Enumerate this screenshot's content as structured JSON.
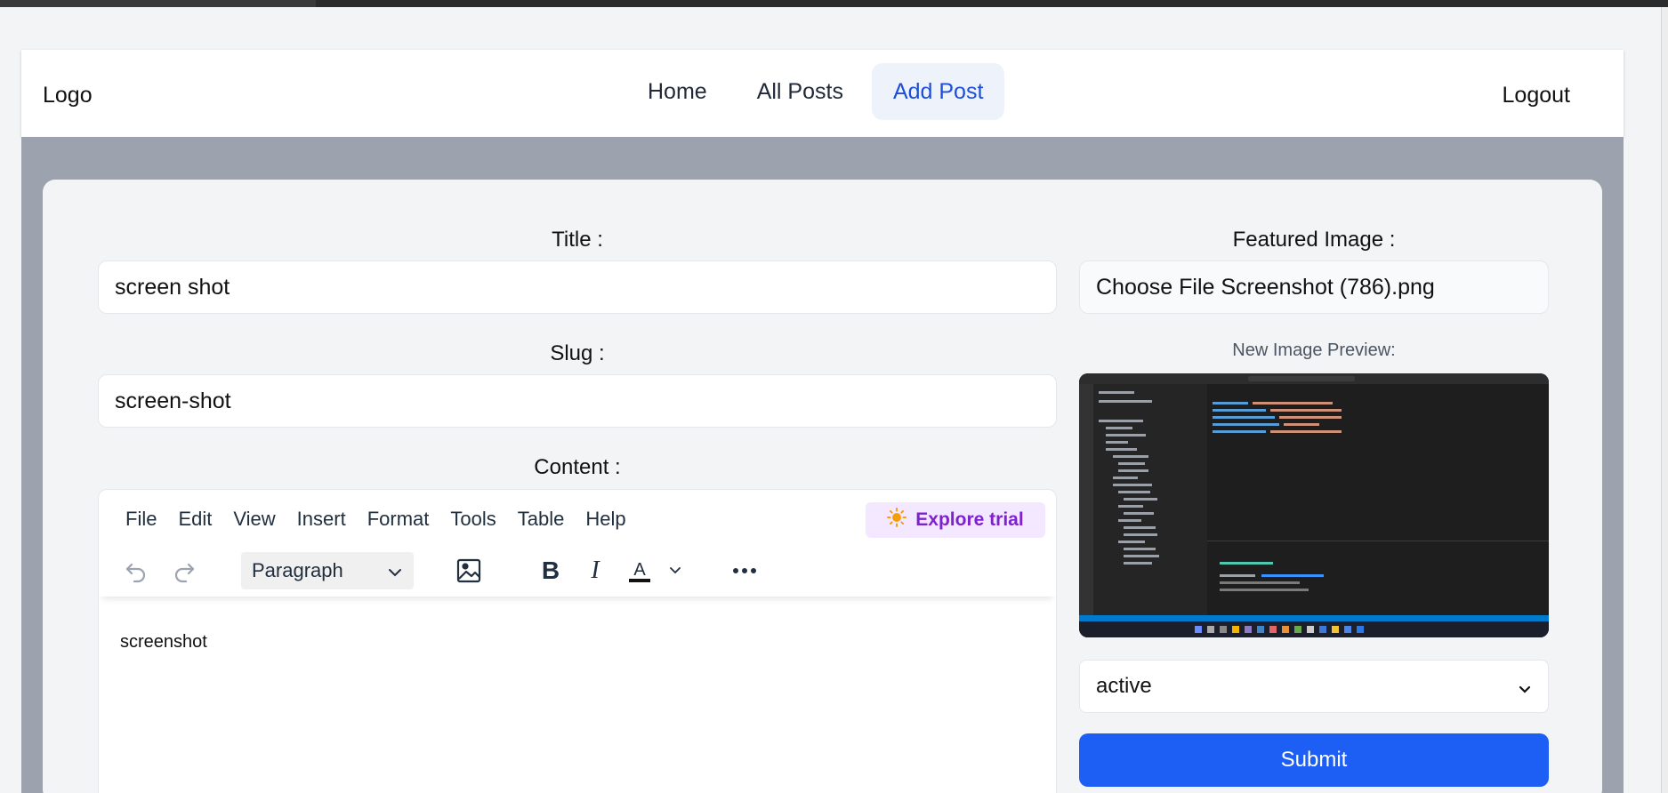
{
  "header": {
    "logo": "Logo",
    "nav": [
      {
        "label": "Home",
        "active": false
      },
      {
        "label": "All Posts",
        "active": false
      },
      {
        "label": "Add Post",
        "active": true
      }
    ],
    "logout": "Logout"
  },
  "form": {
    "title_label": "Title :",
    "title_value": "screen shot",
    "slug_label": "Slug :",
    "slug_value": "screen-shot",
    "content_label": "Content :",
    "featured_label": "Featured Image :",
    "featured_value": "Choose File Screenshot (786).png",
    "preview_label": "New Image Preview:",
    "status_value": "active",
    "submit_label": "Submit"
  },
  "editor": {
    "menu": [
      "File",
      "Edit",
      "View",
      "Insert",
      "Format",
      "Tools",
      "Table",
      "Help"
    ],
    "trial_label": "Explore trial",
    "block_format": "Paragraph",
    "body_text": "screenshot"
  },
  "colors": {
    "accent": "#1d5ff5",
    "nav_active_text": "#1d4ed8",
    "trial_text": "#7e22ce"
  }
}
